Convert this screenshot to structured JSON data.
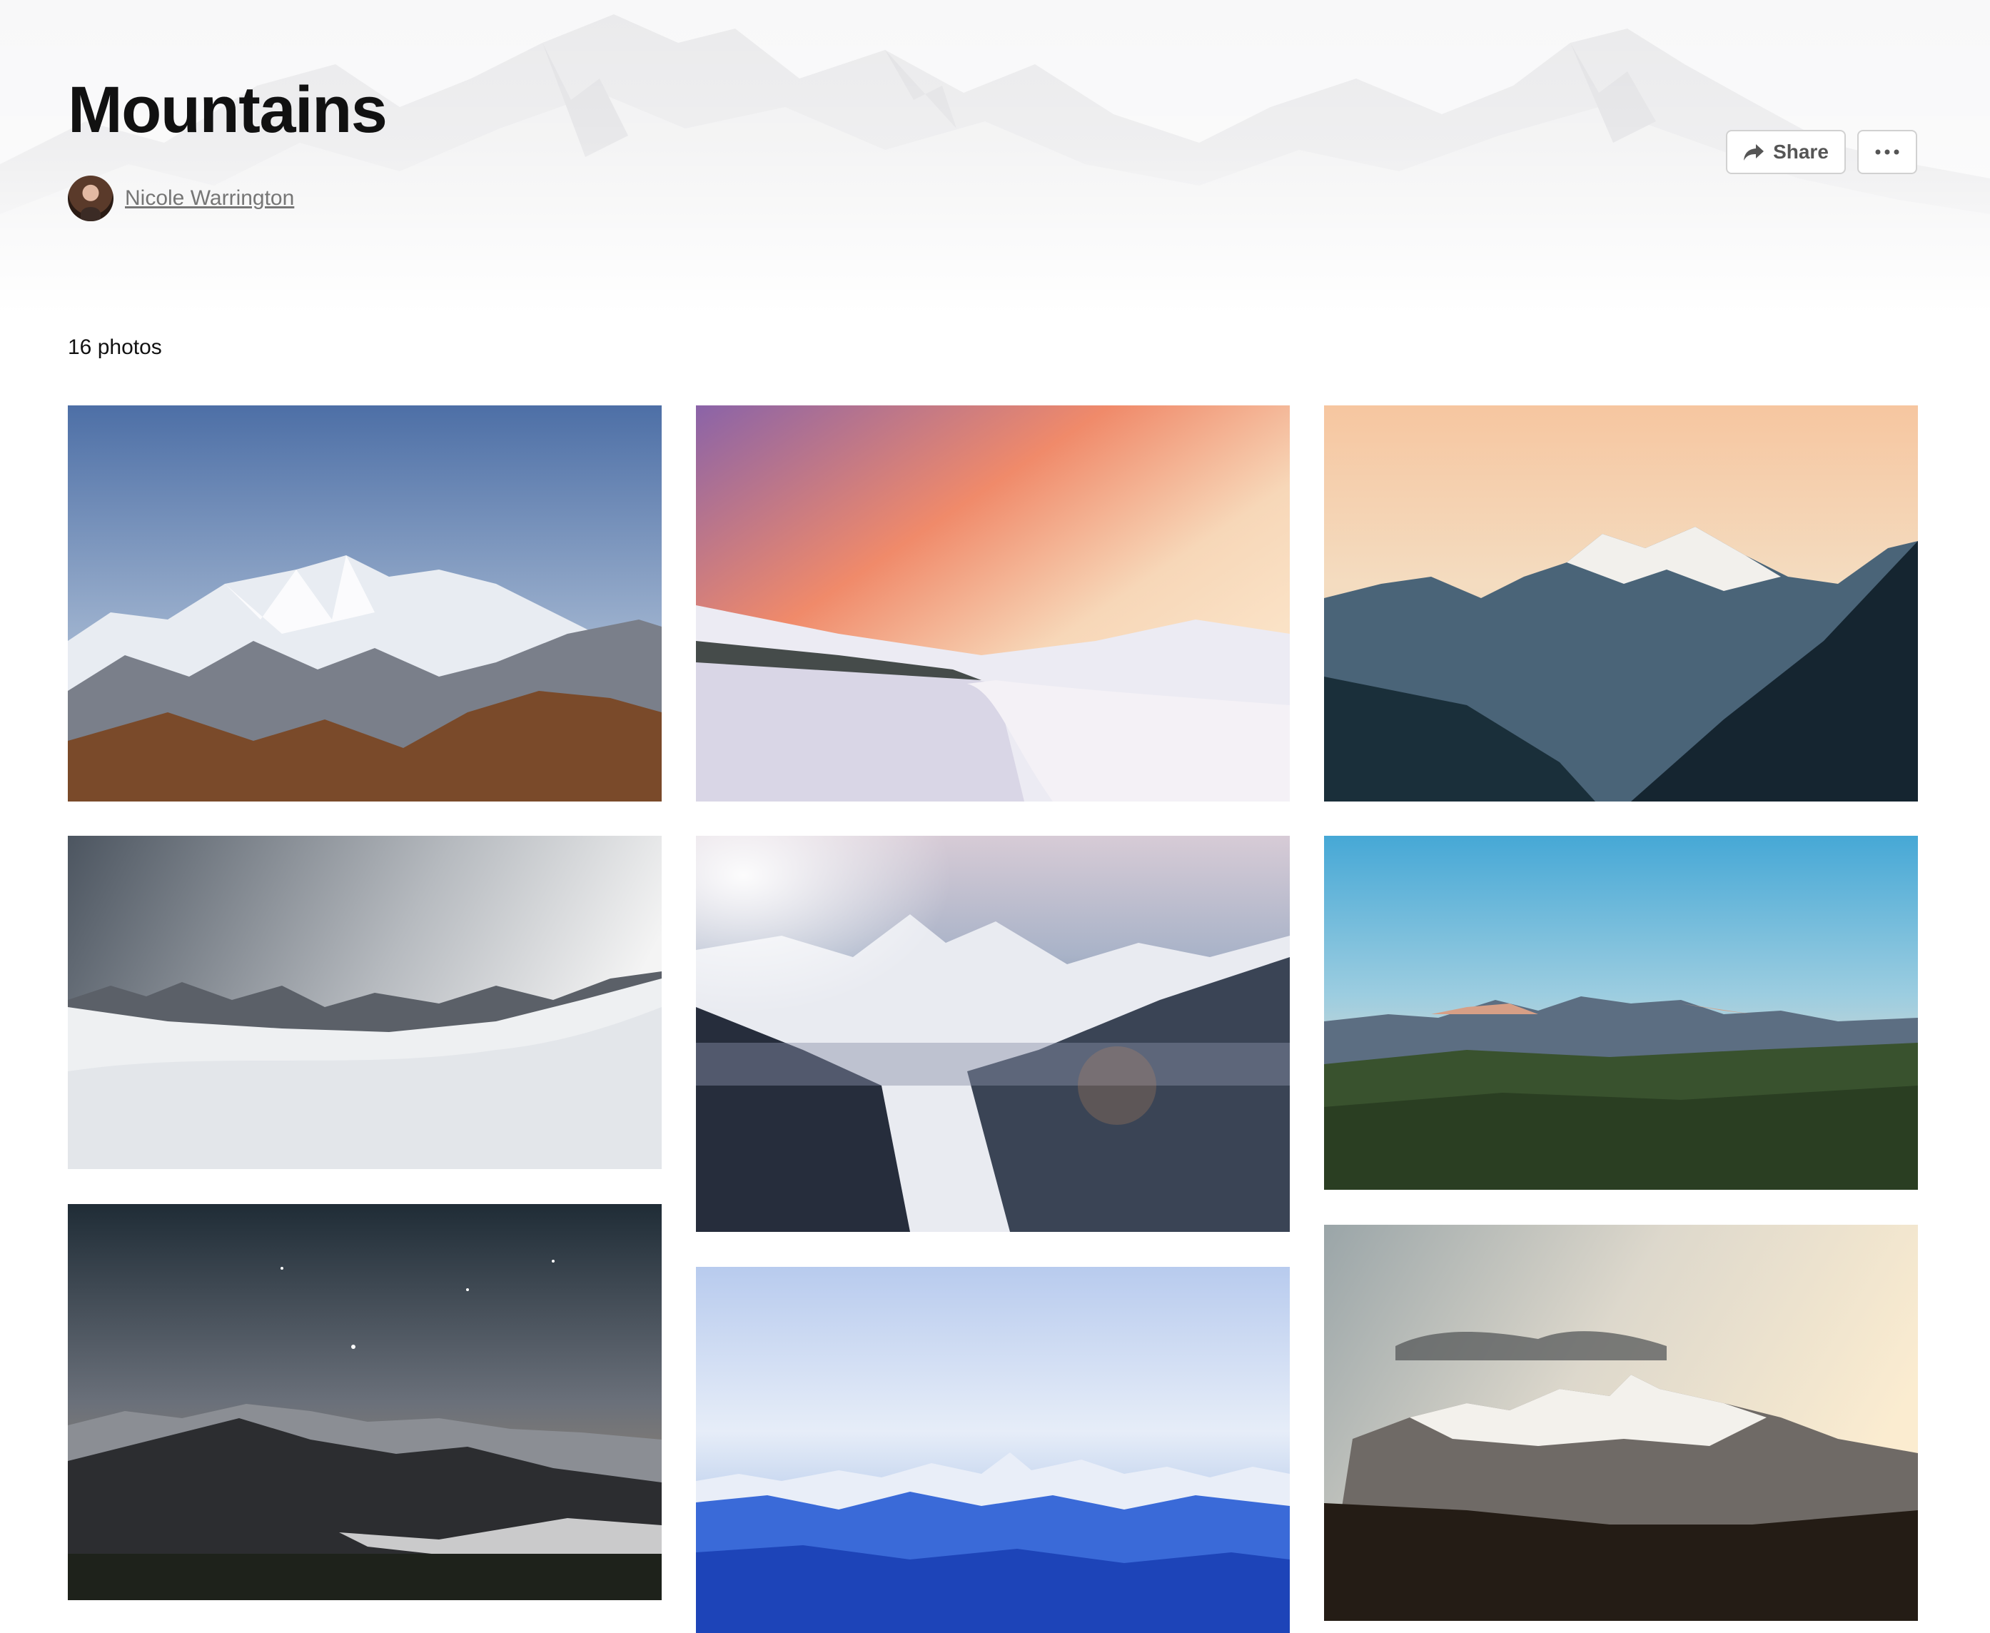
{
  "collection": {
    "title": "Mountains",
    "author": "Nicole Warrington",
    "photo_count_label": "16 photos"
  },
  "actions": {
    "share_label": "Share"
  },
  "photos": [
    {
      "description": "Snowy alpine peaks under blue sky",
      "column": 1,
      "row": 1
    },
    {
      "description": "Snowy road under pink sunset sky",
      "column": 2,
      "row": 1
    },
    {
      "description": "Mont Blanc peak at sunrise over dark valley",
      "column": 3,
      "row": 1
    },
    {
      "description": "Snowfield with distant peaks under grey sky",
      "column": 1,
      "row": 2
    },
    {
      "description": "Valley with snowy mountains and sun flare",
      "column": 2,
      "row": 2
    },
    {
      "description": "Distant rocky range above green hills at dusk",
      "column": 3,
      "row": 2
    },
    {
      "description": "Dark mountain ridge under starry sky",
      "column": 1,
      "row": 3
    },
    {
      "description": "Blue mountain range under light sky",
      "column": 2,
      "row": 3
    },
    {
      "description": "Snowy mountain with clouds at golden hour",
      "column": 3,
      "row": 3
    }
  ],
  "colors": {
    "title": "#111111",
    "muted": "#767676",
    "button_border": "#d1d1d1"
  },
  "icons": [
    "share-icon",
    "more-icon"
  ]
}
